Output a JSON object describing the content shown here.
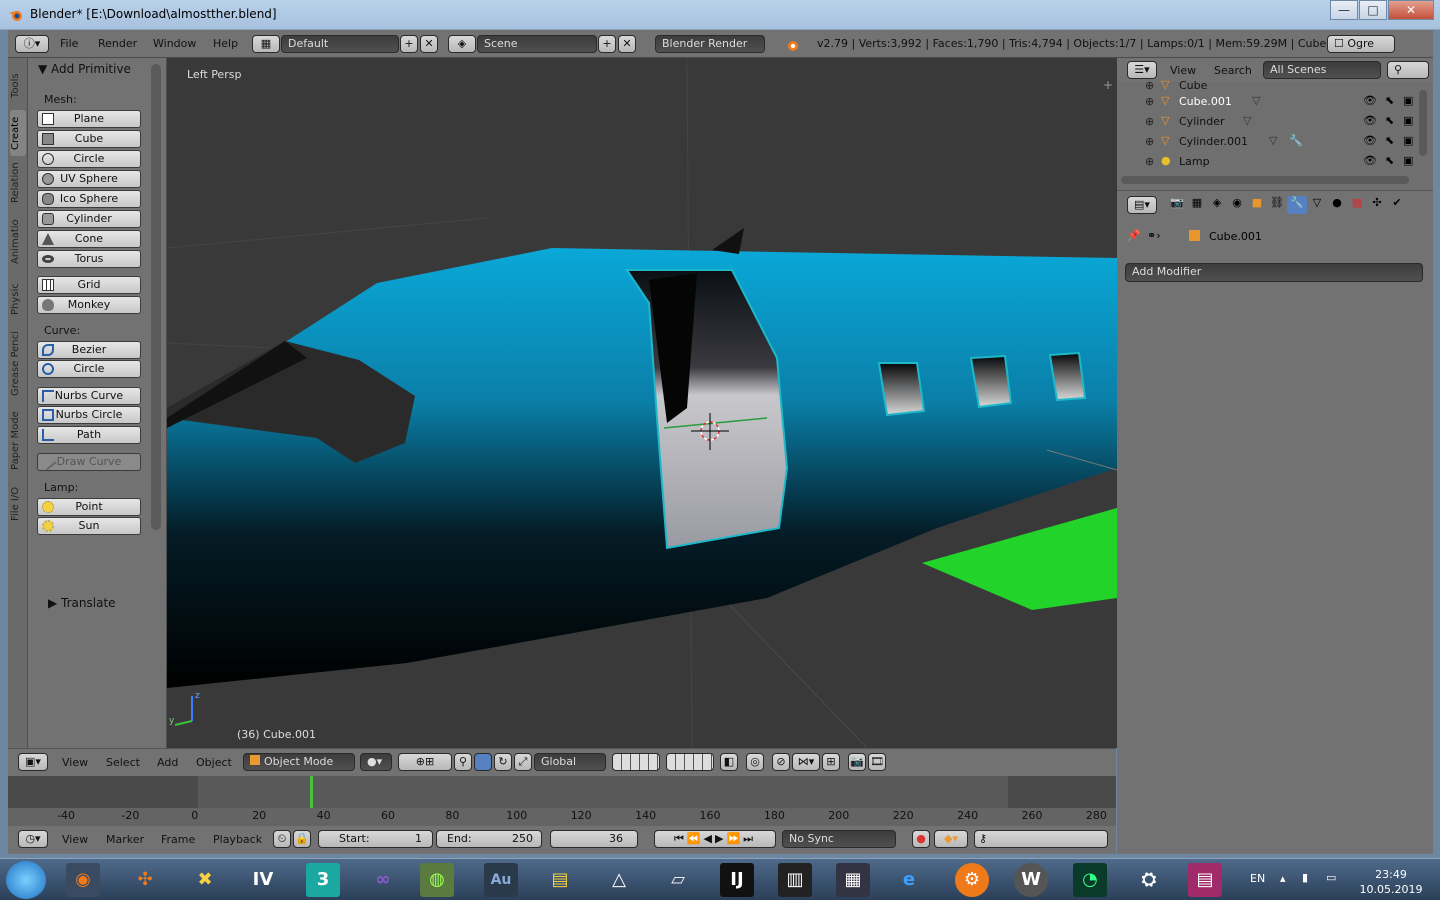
{
  "window": {
    "title": "Blender* [E:\\Download\\almostther.blend]",
    "minimize": "—",
    "maximize": "□",
    "close": "✕"
  },
  "infobar": {
    "menus": [
      "File",
      "Render",
      "Window",
      "Help"
    ],
    "layout": "Default",
    "scene": "Scene",
    "engine": "Blender Render",
    "stats": "v2.79 | Verts:3,992 | Faces:1,790 | Tris:4,794 | Objects:1/7 | Lamps:0/1 | Mem:59.29M | Cube.001",
    "ogre_label": "Ogre"
  },
  "toolshelf": {
    "tabs": [
      "Tools",
      "Create",
      "Relation",
      "Animatio",
      "Physic",
      "Grease Penci",
      "Paper Mode",
      "File I/O"
    ],
    "active_tab": "Create",
    "panel_title": "Add Primitive",
    "mesh_label": "Mesh:",
    "mesh": [
      "Plane",
      "Cube",
      "Circle",
      "UV Sphere",
      "Ico Sphere",
      "Cylinder",
      "Cone",
      "Torus"
    ],
    "mesh2": [
      "Grid",
      "Monkey"
    ],
    "curve_label": "Curve:",
    "curve": [
      "Bezier",
      "Circle"
    ],
    "curve2": [
      "Nurbs Curve",
      "Nurbs Circle",
      "Path"
    ],
    "draw_curve": "Draw Curve",
    "lamp_label": "Lamp:",
    "lamp": [
      "Point",
      "Sun"
    ],
    "translate": "Translate"
  },
  "viewport": {
    "label": "Left Persp",
    "object_info": "(36) Cube.001"
  },
  "view_header": {
    "menus": [
      "View",
      "Select",
      "Add",
      "Object"
    ],
    "mode": "Object Mode",
    "orientation": "Global"
  },
  "timeline": {
    "ticks": [
      "-40",
      "-20",
      "0",
      "20",
      "40",
      "60",
      "80",
      "100",
      "120",
      "140",
      "160",
      "180",
      "200",
      "220",
      "240",
      "260",
      "280"
    ],
    "current_frame": 36,
    "menus": [
      "View",
      "Marker",
      "Frame",
      "Playback"
    ],
    "start_label": "Start:",
    "start": "1",
    "end_label": "End:",
    "end": "250",
    "frame": "36",
    "sync": "No Sync"
  },
  "outliner": {
    "menus": [
      "View",
      "Search"
    ],
    "filter": "All Scenes",
    "rows": [
      {
        "name": "Cube",
        "selected": false
      },
      {
        "name": "Cube.001",
        "selected": true
      },
      {
        "name": "Cylinder",
        "selected": false
      },
      {
        "name": "Cylinder.001",
        "selected": false
      },
      {
        "name": "Lamp",
        "selected": false
      }
    ]
  },
  "properties": {
    "object": "Cube.001",
    "add_modifier": "Add Modifier"
  },
  "taskbar": {
    "lang": "EN",
    "time": "23:49",
    "date": "10.05.2019",
    "apps": [
      "start",
      "blender",
      "app-orange",
      "xcross",
      "iv",
      "3dsmax",
      "visual-studio",
      "globe",
      "audition",
      "explorer",
      "triangle-app",
      "paper",
      "intellij",
      "synth",
      "keyboard",
      "internet-explorer",
      "ubuntu-gear",
      "w-app",
      "speedometer",
      "steam",
      "winrar"
    ]
  },
  "colors": {
    "plane_body": "#0aa8d8",
    "wing": "#22d42a",
    "ui_gray": "#727272",
    "viewport_bg": "#393939"
  }
}
